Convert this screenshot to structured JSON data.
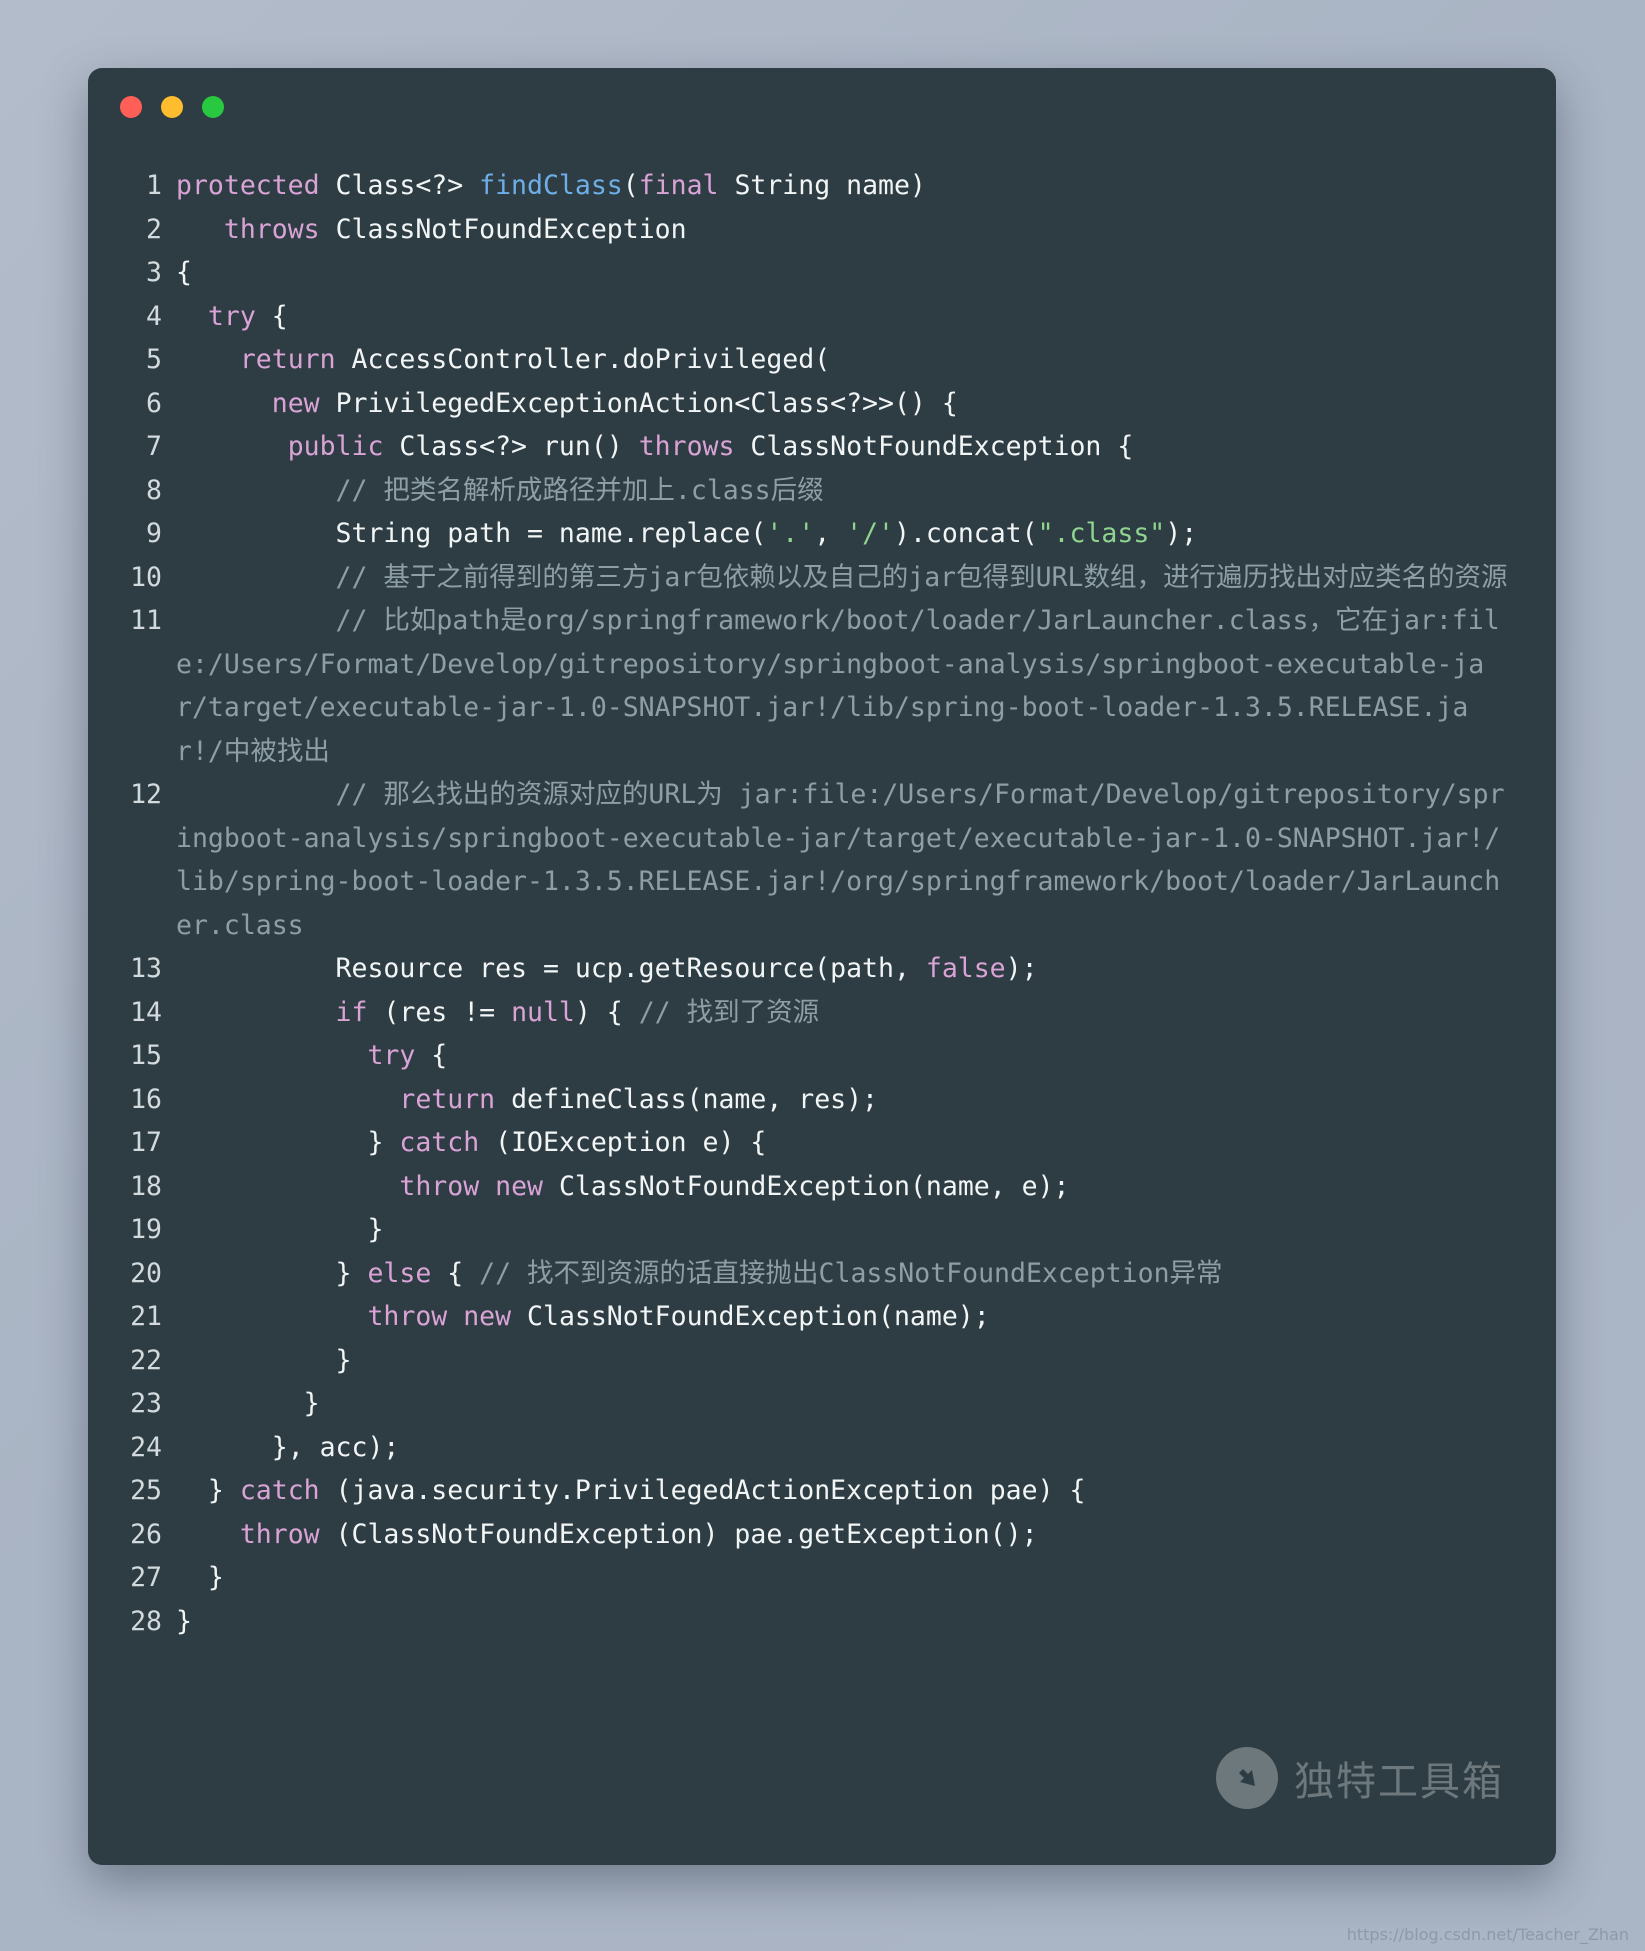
{
  "window": {
    "traffic_lights": [
      {
        "name": "close",
        "color": "#ff5f57"
      },
      {
        "name": "minimize",
        "color": "#febc2e"
      },
      {
        "name": "maximize",
        "color": "#28c840"
      }
    ],
    "background": "#2e3d43",
    "page_background": "#aeb8c8"
  },
  "theme": {
    "keyword": "#d9a3d6",
    "function": "#6eaee8",
    "string": "#8fd48f",
    "comment": "#8d9ea5",
    "plain": "#f2f5f6",
    "line_number": "#d2dadd"
  },
  "code": {
    "language": "java",
    "line_count": 28,
    "lines": [
      {
        "n": "1",
        "text": "protected Class<?> findClass(final String name)"
      },
      {
        "n": "2",
        "text": "   throws ClassNotFoundException"
      },
      {
        "n": "3",
        "text": "{"
      },
      {
        "n": "4",
        "text": "  try {"
      },
      {
        "n": "5",
        "text": "    return AccessController.doPrivileged("
      },
      {
        "n": "6",
        "text": "      new PrivilegedExceptionAction<Class<?>>() {"
      },
      {
        "n": "7",
        "text": "       public Class<?> run() throws ClassNotFoundException {"
      },
      {
        "n": "8",
        "text": "          // 把类名解析成路径并加上.class后缀"
      },
      {
        "n": "9",
        "text": "          String path = name.replace('.', '/').concat(\".class\");"
      },
      {
        "n": "10",
        "text": "          // 基于之前得到的第三方jar包依赖以及自己的jar包得到URL数组，进行遍历找出对应类名的资源"
      },
      {
        "n": "11",
        "text": "          // 比如path是org/springframework/boot/loader/JarLauncher.class，它在jar:file:/Users/Format/Develop/gitrepository/springboot-analysis/springboot-executable-jar/target/executable-jar-1.0-SNAPSHOT.jar!/lib/spring-boot-loader-1.3.5.RELEASE.jar!/中被找出"
      },
      {
        "n": "12",
        "text": "          // 那么找出的资源对应的URL为 jar:file:/Users/Format/Develop/gitrepository/springboot-analysis/springboot-executable-jar/target/executable-jar-1.0-SNAPSHOT.jar!/lib/spring-boot-loader-1.3.5.RELEASE.jar!/org/springframework/boot/loader/JarLauncher.class"
      },
      {
        "n": "13",
        "text": "          Resource res = ucp.getResource(path, false);"
      },
      {
        "n": "14",
        "text": "          if (res != null) { // 找到了资源"
      },
      {
        "n": "15",
        "text": "            try {"
      },
      {
        "n": "16",
        "text": "              return defineClass(name, res);"
      },
      {
        "n": "17",
        "text": "            } catch (IOException e) {"
      },
      {
        "n": "18",
        "text": "              throw new ClassNotFoundException(name, e);"
      },
      {
        "n": "19",
        "text": "            }"
      },
      {
        "n": "20",
        "text": "          } else { // 找不到资源的话直接抛出ClassNotFoundException异常"
      },
      {
        "n": "21",
        "text": "            throw new ClassNotFoundException(name);"
      },
      {
        "n": "22",
        "text": "          }"
      },
      {
        "n": "23",
        "text": "        }"
      },
      {
        "n": "24",
        "text": "      }, acc);"
      },
      {
        "n": "25",
        "text": "  } catch (java.security.PrivilegedActionException pae) {"
      },
      {
        "n": "26",
        "text": "    throw (ClassNotFoundException) pae.getException();"
      },
      {
        "n": "27",
        "text": "  }"
      },
      {
        "n": "28",
        "text": "}"
      }
    ],
    "tokens": [
      [
        {
          "t": "protected",
          "c": "kw"
        },
        {
          "t": " Class<?> ",
          "c": "pl"
        },
        {
          "t": "findClass",
          "c": "fn"
        },
        {
          "t": "(",
          "c": "pl"
        },
        {
          "t": "final",
          "c": "kw"
        },
        {
          "t": " String name)",
          "c": "pl"
        }
      ],
      [
        {
          "t": "   ",
          "c": "pl"
        },
        {
          "t": "throws",
          "c": "kw"
        },
        {
          "t": " ClassNotFoundException",
          "c": "pl"
        }
      ],
      [
        {
          "t": "{",
          "c": "pl"
        }
      ],
      [
        {
          "t": "  ",
          "c": "pl"
        },
        {
          "t": "try",
          "c": "kw"
        },
        {
          "t": " {",
          "c": "pl"
        }
      ],
      [
        {
          "t": "    ",
          "c": "pl"
        },
        {
          "t": "return",
          "c": "kw"
        },
        {
          "t": " AccessController.doPrivileged(",
          "c": "pl"
        }
      ],
      [
        {
          "t": "      ",
          "c": "pl"
        },
        {
          "t": "new",
          "c": "kw"
        },
        {
          "t": " PrivilegedExceptionAction<Class<?>>() {",
          "c": "pl"
        }
      ],
      [
        {
          "t": "       ",
          "c": "pl"
        },
        {
          "t": "public",
          "c": "kw"
        },
        {
          "t": " Class<?> run() ",
          "c": "pl"
        },
        {
          "t": "throws",
          "c": "kw"
        },
        {
          "t": " ClassNotFoundException {",
          "c": "pl"
        }
      ],
      [
        {
          "t": "          // 把类名解析成路径并加上.class后缀",
          "c": "cmt"
        }
      ],
      [
        {
          "t": "          String path = name.replace(",
          "c": "pl"
        },
        {
          "t": "'.'",
          "c": "str"
        },
        {
          "t": ", ",
          "c": "pl"
        },
        {
          "t": "'/'",
          "c": "str"
        },
        {
          "t": ").concat(",
          "c": "pl"
        },
        {
          "t": "\".class\"",
          "c": "str"
        },
        {
          "t": ");",
          "c": "pl"
        }
      ],
      [
        {
          "t": "          // 基于之前得到的第三方jar包依赖以及自己的jar包得到URL数组，进行遍历找出对应类名的资源",
          "c": "cmt"
        }
      ],
      [
        {
          "t": "          // 比如path是org/springframework/boot/loader/JarLauncher.class，它在jar:file:/Users/Format/Develop/gitrepository/springboot-analysis/springboot-executable-jar/target/executable-jar-1.0-SNAPSHOT.jar!/lib/spring-boot-loader-1.3.5.RELEASE.jar!/中被找出",
          "c": "cmt"
        }
      ],
      [
        {
          "t": "          // 那么找出的资源对应的URL为 jar:file:/Users/Format/Develop/gitrepository/springboot-analysis/springboot-executable-jar/target/executable-jar-1.0-SNAPSHOT.jar!/lib/spring-boot-loader-1.3.5.RELEASE.jar!/org/springframework/boot/loader/JarLauncher.class",
          "c": "cmt"
        }
      ],
      [
        {
          "t": "          Resource res = ucp.getResource(path, ",
          "c": "pl"
        },
        {
          "t": "false",
          "c": "kw"
        },
        {
          "t": ");",
          "c": "pl"
        }
      ],
      [
        {
          "t": "          ",
          "c": "pl"
        },
        {
          "t": "if",
          "c": "kw"
        },
        {
          "t": " (res != ",
          "c": "pl"
        },
        {
          "t": "null",
          "c": "kw"
        },
        {
          "t": ") { ",
          "c": "pl"
        },
        {
          "t": "// 找到了资源",
          "c": "cmt"
        }
      ],
      [
        {
          "t": "            ",
          "c": "pl"
        },
        {
          "t": "try",
          "c": "kw"
        },
        {
          "t": " {",
          "c": "pl"
        }
      ],
      [
        {
          "t": "              ",
          "c": "pl"
        },
        {
          "t": "return",
          "c": "kw"
        },
        {
          "t": " defineClass(name, res);",
          "c": "pl"
        }
      ],
      [
        {
          "t": "            } ",
          "c": "pl"
        },
        {
          "t": "catch",
          "c": "kw"
        },
        {
          "t": " (IOException e) {",
          "c": "pl"
        }
      ],
      [
        {
          "t": "              ",
          "c": "pl"
        },
        {
          "t": "throw",
          "c": "kw"
        },
        {
          "t": " ",
          "c": "pl"
        },
        {
          "t": "new",
          "c": "kw"
        },
        {
          "t": " ClassNotFoundException(name, e);",
          "c": "pl"
        }
      ],
      [
        {
          "t": "            }",
          "c": "pl"
        }
      ],
      [
        {
          "t": "          } ",
          "c": "pl"
        },
        {
          "t": "else",
          "c": "kw"
        },
        {
          "t": " { ",
          "c": "pl"
        },
        {
          "t": "// 找不到资源的话直接抛出ClassNotFoundException异常",
          "c": "cmt"
        }
      ],
      [
        {
          "t": "            ",
          "c": "pl"
        },
        {
          "t": "throw",
          "c": "kw"
        },
        {
          "t": " ",
          "c": "pl"
        },
        {
          "t": "new",
          "c": "kw"
        },
        {
          "t": " ClassNotFoundException(name);",
          "c": "pl"
        }
      ],
      [
        {
          "t": "          }",
          "c": "pl"
        }
      ],
      [
        {
          "t": "        }",
          "c": "pl"
        }
      ],
      [
        {
          "t": "      }, acc);",
          "c": "pl"
        }
      ],
      [
        {
          "t": "  } ",
          "c": "pl"
        },
        {
          "t": "catch",
          "c": "kw"
        },
        {
          "t": " (java.security.PrivilegedActionException pae) {",
          "c": "pl"
        }
      ],
      [
        {
          "t": "    ",
          "c": "pl"
        },
        {
          "t": "throw",
          "c": "kw"
        },
        {
          "t": " (ClassNotFoundException) pae.getException();",
          "c": "pl"
        }
      ],
      [
        {
          "t": "  }",
          "c": "pl"
        }
      ],
      [
        {
          "t": "}",
          "c": "pl"
        }
      ]
    ]
  },
  "watermark": {
    "text": "独特工具箱",
    "logo_icon": "arrow-up-left-icon"
  },
  "footer": {
    "url": "https://blog.csdn.net/Teacher_Zhan"
  }
}
